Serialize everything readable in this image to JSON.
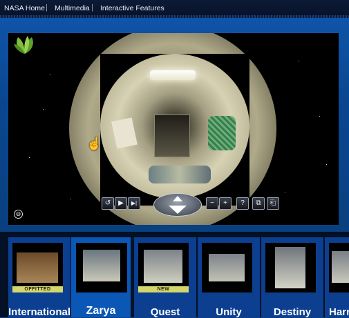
{
  "nav": {
    "crumbs": [
      "NASA Home",
      "Multimedia",
      "Interactive Features"
    ],
    "separator": "|"
  },
  "viewer": {
    "controls": {
      "rotate_back_icon": "↺",
      "play_icon": "▶",
      "step_forward_icon": "▶|",
      "zoom_out": "−",
      "zoom_in": "+",
      "help": "?",
      "fullscreen_icon": "⧉",
      "exit_icon": "⎗"
    },
    "close_icon": "⊖"
  },
  "modules": [
    {
      "name": "International",
      "badge": "OFFITTED"
    },
    {
      "name": "Zarya",
      "badge": "",
      "selected": true
    },
    {
      "name": "Quest",
      "badge": "NEW"
    },
    {
      "name": "Unity",
      "badge": ""
    },
    {
      "name": "Destiny",
      "badge": ""
    },
    {
      "name": "Harr",
      "badge": ""
    }
  ],
  "colors": {
    "panel_blue": "#0a4690",
    "selected_card": "#0a57b6",
    "card": "#0c3f8f",
    "badge_yellow": "#d6d76a"
  }
}
